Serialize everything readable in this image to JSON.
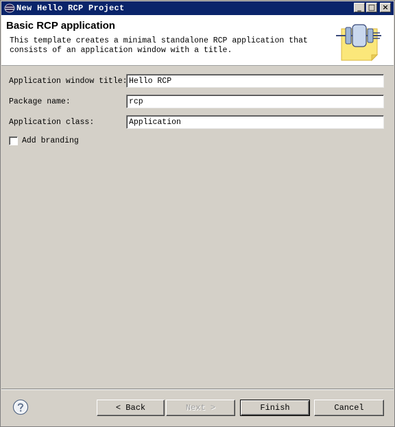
{
  "window": {
    "title": "New Hello RCP Project",
    "minimize_glyph": "_",
    "maximize_glyph": "□",
    "close_glyph": "×"
  },
  "banner": {
    "title": "Basic RCP application",
    "description": "This template creates a minimal standalone RCP application that consists of an application window with a title.",
    "graphic_icon": "plugin-wizard-graphic"
  },
  "form": {
    "app_title_label": "Application window title:",
    "app_title_value": "Hello RCP",
    "package_label": "Package name:",
    "package_value": "rcp",
    "app_class_label": "Application class:",
    "app_class_value": "Application",
    "branding_label": "Add branding",
    "branding_checked": false
  },
  "footer": {
    "help_icon": "help-icon",
    "back_label": "< Back",
    "next_label": "Next >",
    "finish_label": "Finish",
    "cancel_label": "Cancel"
  },
  "colors": {
    "titlebar": "#0a246a",
    "dialog_bg": "#d4d0c8",
    "banner_bg": "#ffffff"
  }
}
